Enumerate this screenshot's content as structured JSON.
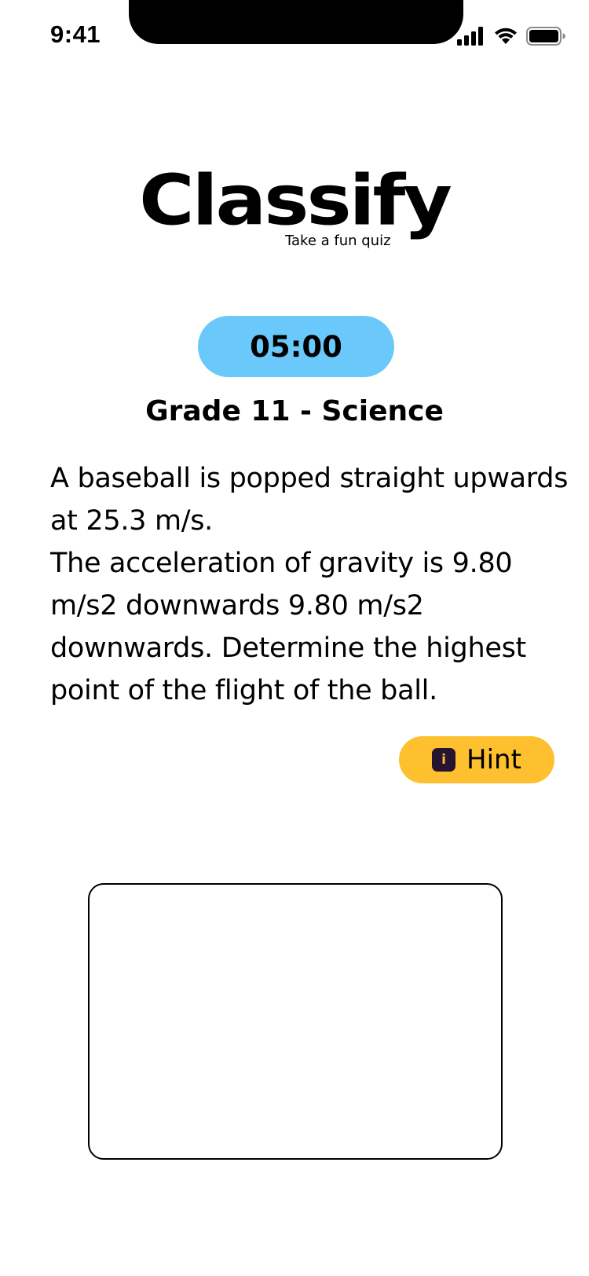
{
  "status_bar": {
    "time": "9:41",
    "icons": [
      "cellular-signal-icon",
      "wifi-icon",
      "battery-icon"
    ]
  },
  "logo": {
    "title": "Classify",
    "tagline": "Take a fun quiz"
  },
  "timer": {
    "value": "05:00",
    "color": "#6ac8fa"
  },
  "quiz": {
    "subject": "Grade 11 - Science",
    "question_lines": [
      "A baseball is popped straight upwards at 25.3 m/s.",
      "The acceleration of gravity is 9.80 m/s2 downwards 9.80 m/s2 downwards. Determine the highest point of the flight of the ball."
    ]
  },
  "hint": {
    "icon": "info-icon",
    "icon_glyph": "i",
    "label": "Hint",
    "color": "#fec02f"
  },
  "answer": {
    "value": "",
    "placeholder": ""
  }
}
